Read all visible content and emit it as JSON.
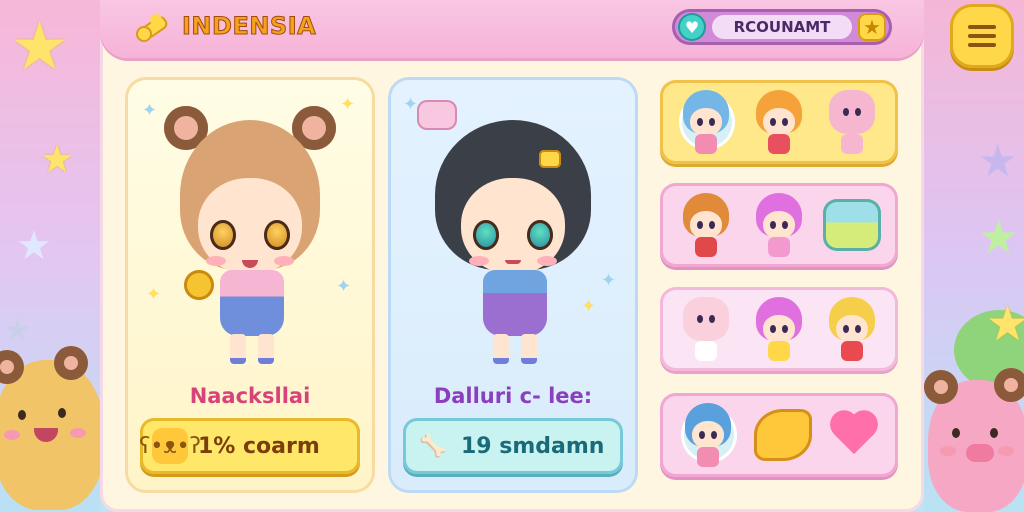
{
  "header": {
    "brand_title": "INDENSIA",
    "account_label": "RCOUNAMT"
  },
  "cards": [
    {
      "name": "Naacksllai",
      "button_label": "1% coarm"
    },
    {
      "name": "Dalluri c- lee:",
      "button_label": "19 smdamn"
    }
  ],
  "colors": {
    "header_pink": "#f6b3d8",
    "panel_cream": "#fff6e1",
    "gold": "#ffd84a",
    "account_purple": "#d08ad7",
    "card1_button": "#ffe76a",
    "card2_button": "#c9f3f0"
  },
  "icons": {
    "brand": "bone-icon",
    "account_left": "heart-icon",
    "account_right": "star-icon",
    "menu": "hamburger-menu-icon",
    "card1_button": "bear-icon",
    "card2_button": "bone-icon"
  }
}
